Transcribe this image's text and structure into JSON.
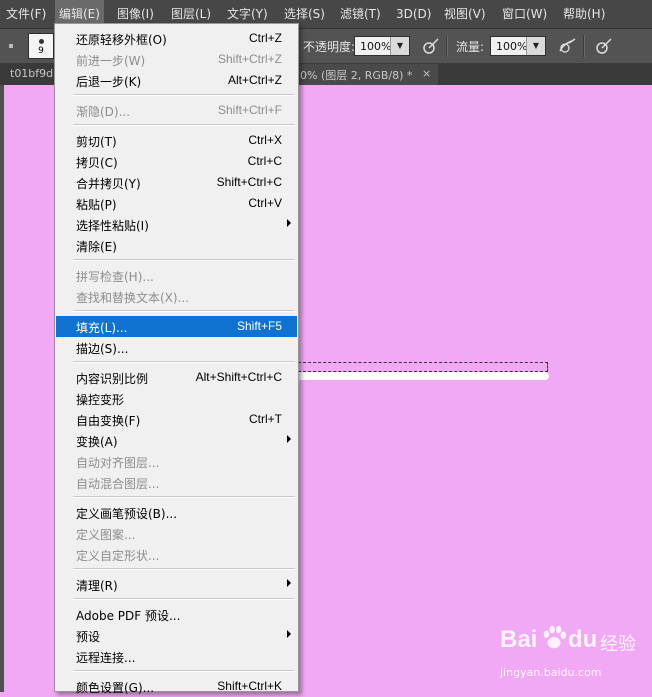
{
  "menubar": {
    "items": [
      {
        "label": "文件(F)"
      },
      {
        "label": "编辑(E)"
      },
      {
        "label": "图像(I)"
      },
      {
        "label": "图层(L)"
      },
      {
        "label": "文字(Y)"
      },
      {
        "label": "选择(S)"
      },
      {
        "label": "滤镜(T)"
      },
      {
        "label": "3D(D)"
      },
      {
        "label": "视图(V)"
      },
      {
        "label": "窗口(W)"
      },
      {
        "label": "帮助(H)"
      }
    ]
  },
  "options": {
    "brush_size": "9",
    "opacity_label": "不透明度:",
    "opacity_value": "100%",
    "flow_label": "流量:",
    "flow_value": "100%"
  },
  "tabs": {
    "left_text": "t01bf9d",
    "right_text": "0% (图层 2, RGB/8) *",
    "close_glyph": "×"
  },
  "edit_menu": {
    "items": [
      {
        "label": "还原轻移外框(O)",
        "shortcut": "Ctrl+Z",
        "disabled": false
      },
      {
        "label": "前进一步(W)",
        "shortcut": "Shift+Ctrl+Z",
        "disabled": true
      },
      {
        "label": "后退一步(K)",
        "shortcut": "Alt+Ctrl+Z",
        "disabled": false
      },
      {
        "label": "渐隐(D)...",
        "shortcut": "Shift+Ctrl+F",
        "disabled": true
      },
      {
        "label": "剪切(T)",
        "shortcut": "Ctrl+X",
        "disabled": false
      },
      {
        "label": "拷贝(C)",
        "shortcut": "Ctrl+C",
        "disabled": false
      },
      {
        "label": "合并拷贝(Y)",
        "shortcut": "Shift+Ctrl+C",
        "disabled": false
      },
      {
        "label": "粘贴(P)",
        "shortcut": "Ctrl+V",
        "disabled": false
      },
      {
        "label": "选择性粘贴(I)",
        "shortcut": "",
        "disabled": false
      },
      {
        "label": "清除(E)",
        "shortcut": "",
        "disabled": false
      },
      {
        "label": "拼写检查(H)...",
        "shortcut": "",
        "disabled": true
      },
      {
        "label": "查找和替换文本(X)...",
        "shortcut": "",
        "disabled": true
      },
      {
        "label": "填充(L)...",
        "shortcut": "Shift+F5",
        "disabled": false
      },
      {
        "label": "描边(S)...",
        "shortcut": "",
        "disabled": false
      },
      {
        "label": "内容识别比例",
        "shortcut": "Alt+Shift+Ctrl+C",
        "disabled": false
      },
      {
        "label": "操控变形",
        "shortcut": "",
        "disabled": false
      },
      {
        "label": "自由变换(F)",
        "shortcut": "Ctrl+T",
        "disabled": false
      },
      {
        "label": "变换(A)",
        "shortcut": "",
        "disabled": false
      },
      {
        "label": "自动对齐图层...",
        "shortcut": "",
        "disabled": true
      },
      {
        "label": "自动混合图层...",
        "shortcut": "",
        "disabled": true
      },
      {
        "label": "定义画笔预设(B)...",
        "shortcut": "",
        "disabled": false
      },
      {
        "label": "定义图案...",
        "shortcut": "",
        "disabled": true
      },
      {
        "label": "定义自定形状...",
        "shortcut": "",
        "disabled": true
      },
      {
        "label": "清理(R)",
        "shortcut": "",
        "disabled": false
      },
      {
        "label": "Adobe PDF 预设...",
        "shortcut": "",
        "disabled": false
      },
      {
        "label": "预设",
        "shortcut": "",
        "disabled": false
      },
      {
        "label": "远程连接...",
        "shortcut": "",
        "disabled": false
      },
      {
        "label": "颜色设置(G)...",
        "shortcut": "Shift+Ctrl+K",
        "disabled": false
      }
    ]
  },
  "watermark": {
    "brand_latin_1": "Bai",
    "brand_latin_2": "du",
    "brand_cn": "经验",
    "url": "jingyan.baidu.com"
  },
  "colors": {
    "canvas": "#f2a9f5",
    "menu_highlight": "#0e73d0"
  }
}
